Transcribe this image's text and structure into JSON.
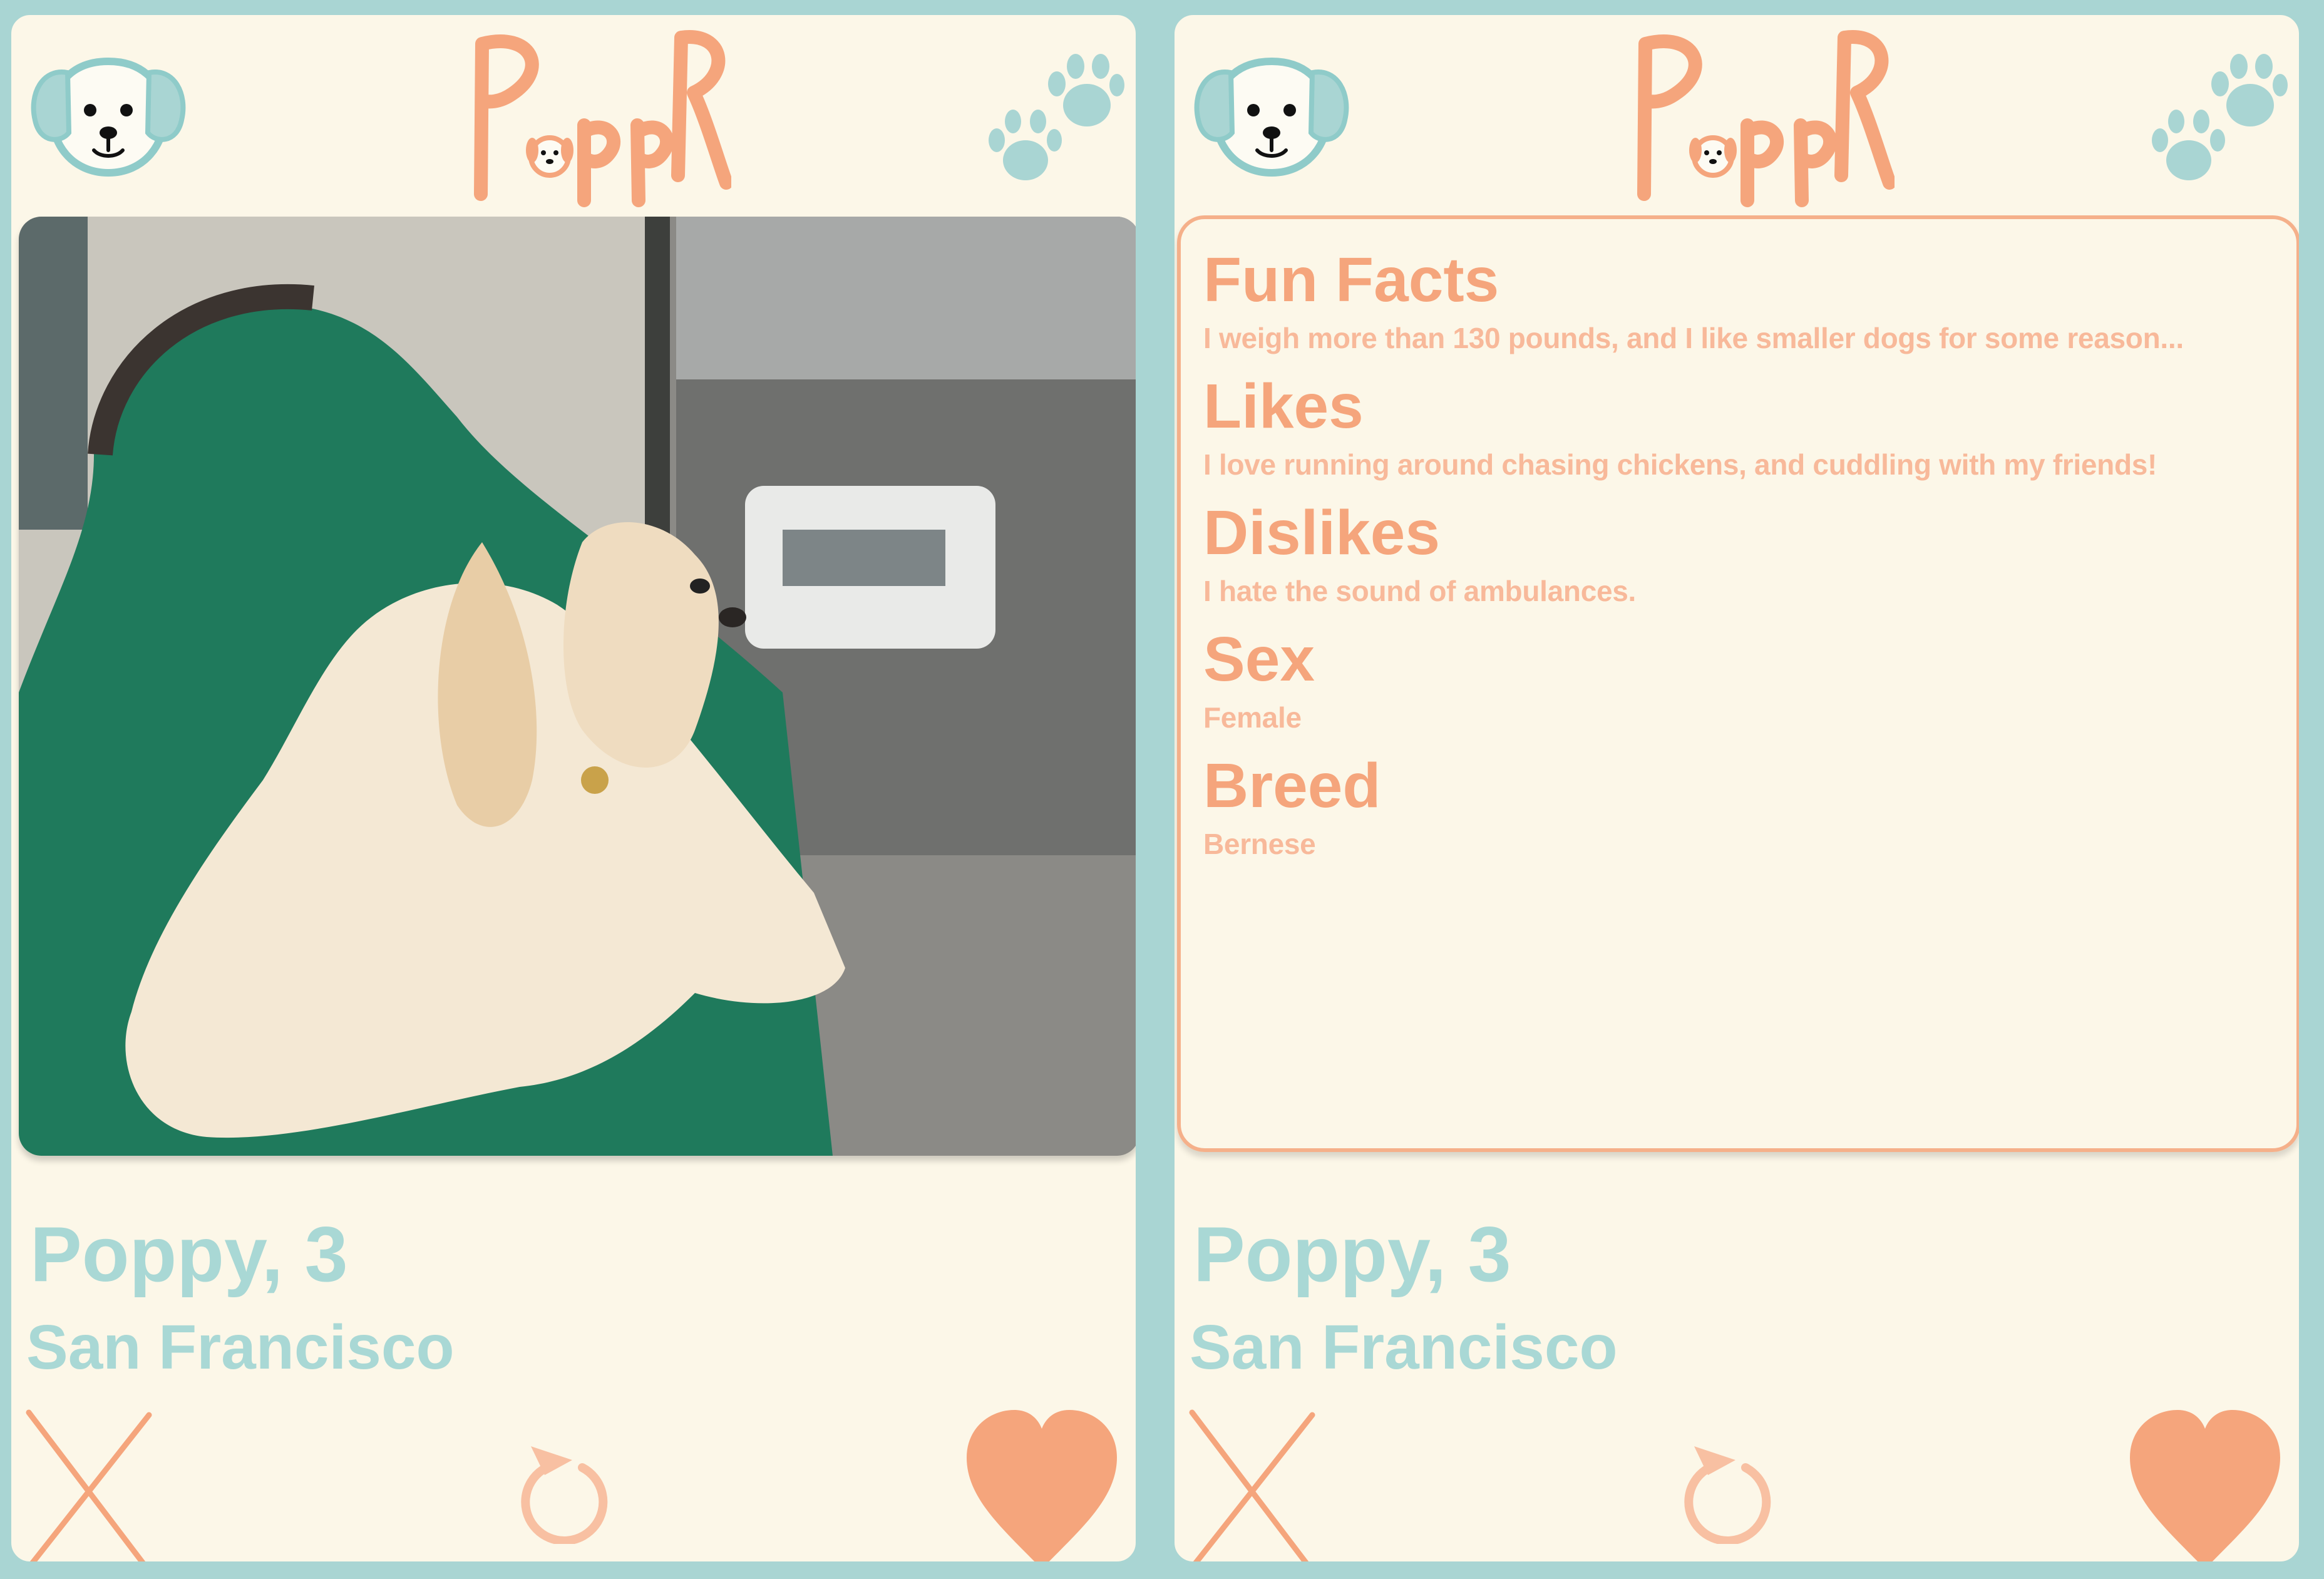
{
  "brand": {
    "logo_text": "PuppR"
  },
  "profile": {
    "name_age": "Poppy, 3",
    "location": "San Francisco"
  },
  "facts": [
    {
      "heading": "Fun Facts",
      "text": "I weigh more than 130 pounds, and I like smaller dogs for some reason..."
    },
    {
      "heading": "Likes",
      "text": "I love running around chasing chickens, and cuddling with my friends!"
    },
    {
      "heading": "Dislikes",
      "text": "I hate the sound of ambulances."
    },
    {
      "heading": "Sex",
      "text": "Female"
    },
    {
      "heading": "Breed",
      "text": "Bernese"
    }
  ],
  "actions": {
    "nope": "x-icon",
    "rewind": "rewind-icon",
    "like": "heart-icon"
  },
  "colors": {
    "background": "#fcf7e8",
    "teal": "#a9d5d3",
    "orange": "#f5a57c",
    "light_orange": "#f8b99a",
    "green_chair": "#1f7a5c"
  }
}
